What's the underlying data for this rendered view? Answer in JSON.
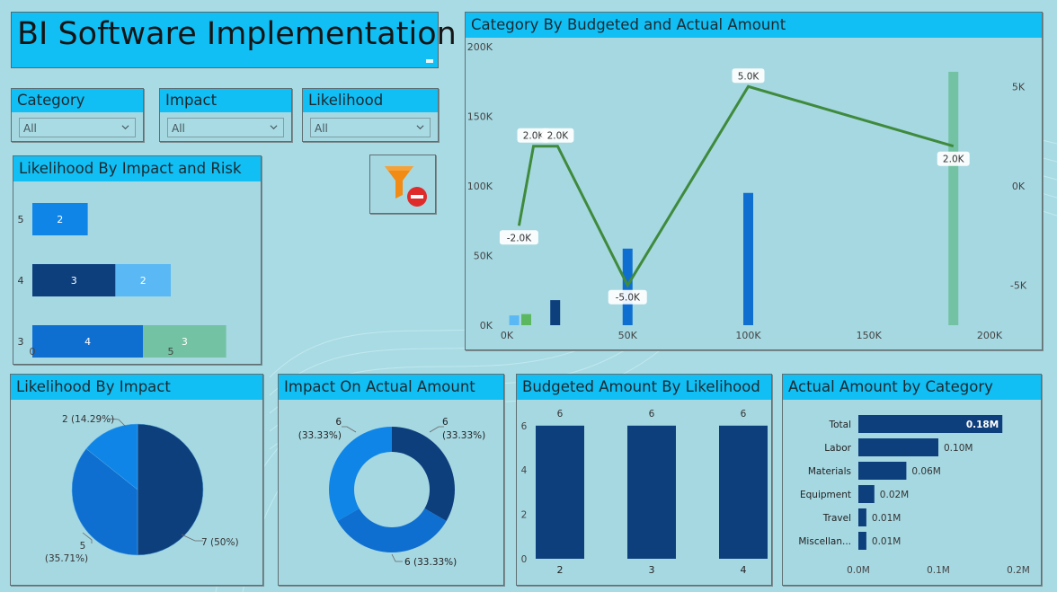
{
  "page": {
    "title": "BI Software Implementation"
  },
  "slicers": [
    {
      "label": "Category",
      "value": "All"
    },
    {
      "label": "Impact",
      "value": "All"
    },
    {
      "label": "Likelihood",
      "value": "All"
    }
  ],
  "panels": {
    "combo": "Category By Budgeted and Actual Amount",
    "stacked": "Likelihood By Impact and Risk",
    "pie": "Likelihood By Impact",
    "donut": "Impact On Actual Amount",
    "col": "Budgeted Amount By Likelihood",
    "hbar": "Actual Amount by Category"
  },
  "icons": {
    "clear_filters": "clear-filters-icon"
  },
  "colors": {
    "header": "#11bff5",
    "dark": "#0e3f7d",
    "mid": "#0f6fd0",
    "light": "#5ab8f4",
    "teal": "#72c2a3",
    "line": "#3f8a3c"
  },
  "chart_data": [
    {
      "id": "combo",
      "type": "bar",
      "title": "Category By Budgeted and Actual Amount",
      "x_ticks": [
        "0K",
        "50K",
        "100K",
        "150K",
        "200K"
      ],
      "y_ticks": [
        "0K",
        "50K",
        "100K",
        "150K",
        "200K"
      ],
      "y2_ticks": [
        "-5K",
        "0K",
        "5K"
      ],
      "xlim": [
        0,
        200000
      ],
      "ylim": [
        0,
        200000
      ],
      "y2lim": [
        -7000,
        7000
      ],
      "bars": [
        {
          "x": 3000,
          "value": 7000,
          "color": "#5ab8f4"
        },
        {
          "x": 8000,
          "value": 8000,
          "color": "#5cb860"
        },
        {
          "x": 20000,
          "value": 18000,
          "color": "#0e3f7d"
        },
        {
          "x": 50000,
          "value": 55000,
          "color": "#0f6fd0"
        },
        {
          "x": 100000,
          "value": 95000,
          "color": "#0f6fd0"
        },
        {
          "x": 185000,
          "value": 182000,
          "color": "#72c2a3"
        }
      ],
      "line": {
        "x": [
          5000,
          11000,
          21000,
          50000,
          100000,
          185000
        ],
        "y": [
          -2000,
          2000,
          2000,
          -5000,
          5000,
          2000
        ],
        "labels": [
          "-2.0K",
          "2.0K",
          "2.0K",
          "-5.0K",
          "5.0K",
          "2.0K"
        ]
      }
    },
    {
      "id": "stacked",
      "type": "bar",
      "title": "Likelihood By Impact and Risk",
      "categories": [
        "5",
        "4",
        "3"
      ],
      "x_ticks": [
        "0",
        "5"
      ],
      "xlim": [
        0,
        5
      ],
      "segments": [
        [
          {
            "value": 2,
            "label": "2",
            "color": "#0f85e8"
          }
        ],
        [
          {
            "value": 3,
            "label": "3",
            "color": "#0e3f7d"
          },
          {
            "value": 2,
            "label": "2",
            "color": "#5ab8f4"
          }
        ],
        [
          {
            "value": 4,
            "label": "4",
            "color": "#0f6fd0"
          },
          {
            "value": 3,
            "label": "3",
            "color": "#72c2a3"
          }
        ]
      ]
    },
    {
      "id": "pie",
      "type": "pie",
      "title": "Likelihood By Impact",
      "slices": [
        {
          "value": 7,
          "label": "7 (50%)",
          "color": "#0e3f7d"
        },
        {
          "value": 5,
          "label": "5 (35.71%)",
          "color": "#0f6fd0"
        },
        {
          "value": 2,
          "label": "2 (14.29%)",
          "color": "#0f85e8"
        }
      ]
    },
    {
      "id": "donut",
      "type": "pie",
      "title": "Impact On Actual Amount",
      "slices": [
        {
          "value": 6,
          "label": "6 (33.33%)",
          "color": "#0e3f7d"
        },
        {
          "value": 6,
          "label": "6 (33.33%)",
          "color": "#0f6fd0"
        },
        {
          "value": 6,
          "label": "6 (33.33%)",
          "color": "#0f85e8"
        }
      ]
    },
    {
      "id": "col",
      "type": "bar",
      "title": "Budgeted Amount By Likelihood",
      "categories": [
        "2",
        "3",
        "4"
      ],
      "values": [
        6,
        6,
        6
      ],
      "data_labels": [
        "6",
        "6",
        "6"
      ],
      "y_ticks": [
        "0",
        "2",
        "4",
        "6"
      ],
      "ylim": [
        0,
        6.6
      ]
    },
    {
      "id": "hbar",
      "type": "bar",
      "title": "Actual Amount by Category",
      "categories": [
        "Total",
        "Labor",
        "Materials",
        "Equipment",
        "Travel",
        "Miscellan..."
      ],
      "values": [
        0.18,
        0.1,
        0.06,
        0.02,
        0.01,
        0.01
      ],
      "data_labels": [
        "0.18M",
        "0.10M",
        "0.06M",
        "0.02M",
        "0.01M",
        "0.01M"
      ],
      "x_ticks": [
        "0.0M",
        "0.1M",
        "0.2M"
      ],
      "xlim": [
        0,
        0.2
      ]
    }
  ]
}
